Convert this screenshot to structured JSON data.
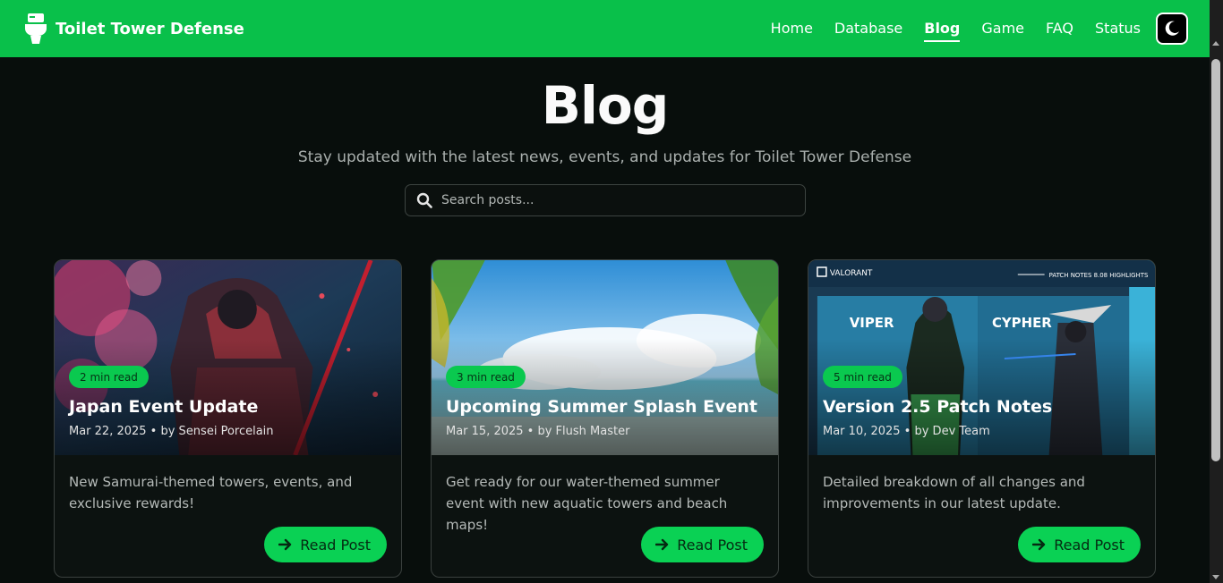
{
  "brand": {
    "title": "Toilet Tower Defense",
    "icon": "toilet-icon"
  },
  "nav": {
    "items": [
      {
        "label": "Home",
        "active": false
      },
      {
        "label": "Database",
        "active": false
      },
      {
        "label": "Blog",
        "active": true
      },
      {
        "label": "Game",
        "active": false
      },
      {
        "label": "FAQ",
        "active": false
      },
      {
        "label": "Status",
        "active": false
      }
    ],
    "theme_toggle_icon": "moon-icon"
  },
  "page": {
    "title": "Blog",
    "subtitle": "Stay updated with the latest news, events, and updates for Toilet Tower Defense"
  },
  "search": {
    "placeholder": "Search posts...",
    "value": "",
    "icon": "search-icon"
  },
  "posts": [
    {
      "read_time": "2 min read",
      "title": "Japan Event Update",
      "meta": "Mar 22, 2025 • by Sensei Porcelain",
      "description": "New Samurai-themed towers, events, and exclusive rewards!",
      "button": "Read Post"
    },
    {
      "read_time": "3 min read",
      "title": "Upcoming Summer Splash Event",
      "meta": "Mar 15, 2025 • by Flush Master",
      "description": "Get ready for our water-themed summer event with new aquatic towers and beach maps!",
      "button": "Read Post"
    },
    {
      "read_time": "5 min read",
      "title": "Version 2.5 Patch Notes",
      "meta": "Mar 10, 2025 • by Dev Team",
      "description": "Detailed breakdown of all changes and improvements in our latest update.",
      "button": "Read Post"
    }
  ],
  "patch_image_text": {
    "brand": "VALORANT",
    "header": "PATCH NOTES 8.08 HIGHLIGHTS",
    "agent_left": "VIPER",
    "agent_right": "CYPHER"
  },
  "colors": {
    "accent": "#09c04a",
    "background": "#080e0c",
    "button": "#0ad154"
  }
}
